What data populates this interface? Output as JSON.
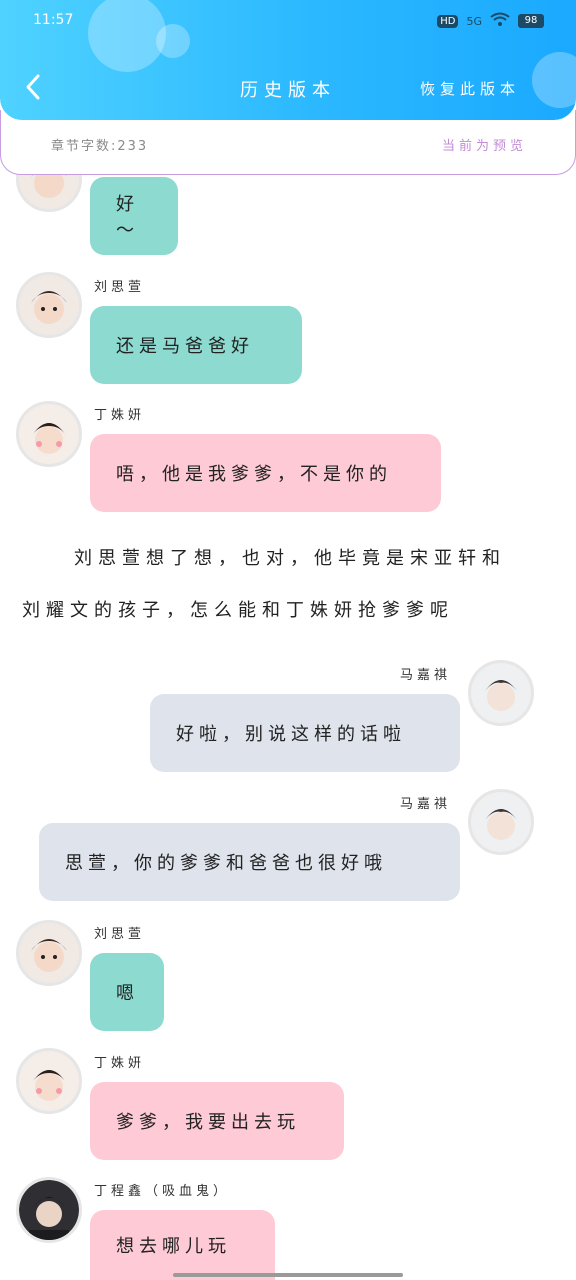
{
  "status_bar": {
    "time": "11:57",
    "battery": "98",
    "network": "5G",
    "hd_label": "HD"
  },
  "header": {
    "title": "历史版本",
    "restore_label": "恢复此版本"
  },
  "subbar": {
    "word_count": "章节字数:233",
    "preview_label": "当前为预览"
  },
  "messages": [
    {
      "name": "",
      "text": "好～"
    },
    {
      "name": "刘思萱",
      "text": "还是马爸爸好"
    },
    {
      "name": "丁姝妍",
      "text": "唔，他是我爹爹，不是你的"
    },
    {
      "name": "马嘉祺",
      "text": "好啦，别说这样的话啦"
    },
    {
      "name": "马嘉祺",
      "text": "思萱，你的爹爹和爸爸也很好哦"
    },
    {
      "name": "刘思萱",
      "text": "嗯"
    },
    {
      "name": "丁姝妍",
      "text": "爹爹，我要出去玩"
    },
    {
      "name": "丁程鑫（吸血鬼）",
      "text": "想去哪儿玩"
    }
  ],
  "narration": {
    "line1": "刘思萱想了想，也对，他毕竟是宋亚轩和",
    "line2": "刘耀文的孩子，怎么能和丁姝妍抢爹爹呢"
  },
  "colors": {
    "header_start": "#4fd2ff",
    "header_end": "#1aa9ff",
    "green_bubble": "#8cdad0",
    "pink_bubble": "#fdcad6",
    "gray_bubble": "#dee3ec"
  }
}
